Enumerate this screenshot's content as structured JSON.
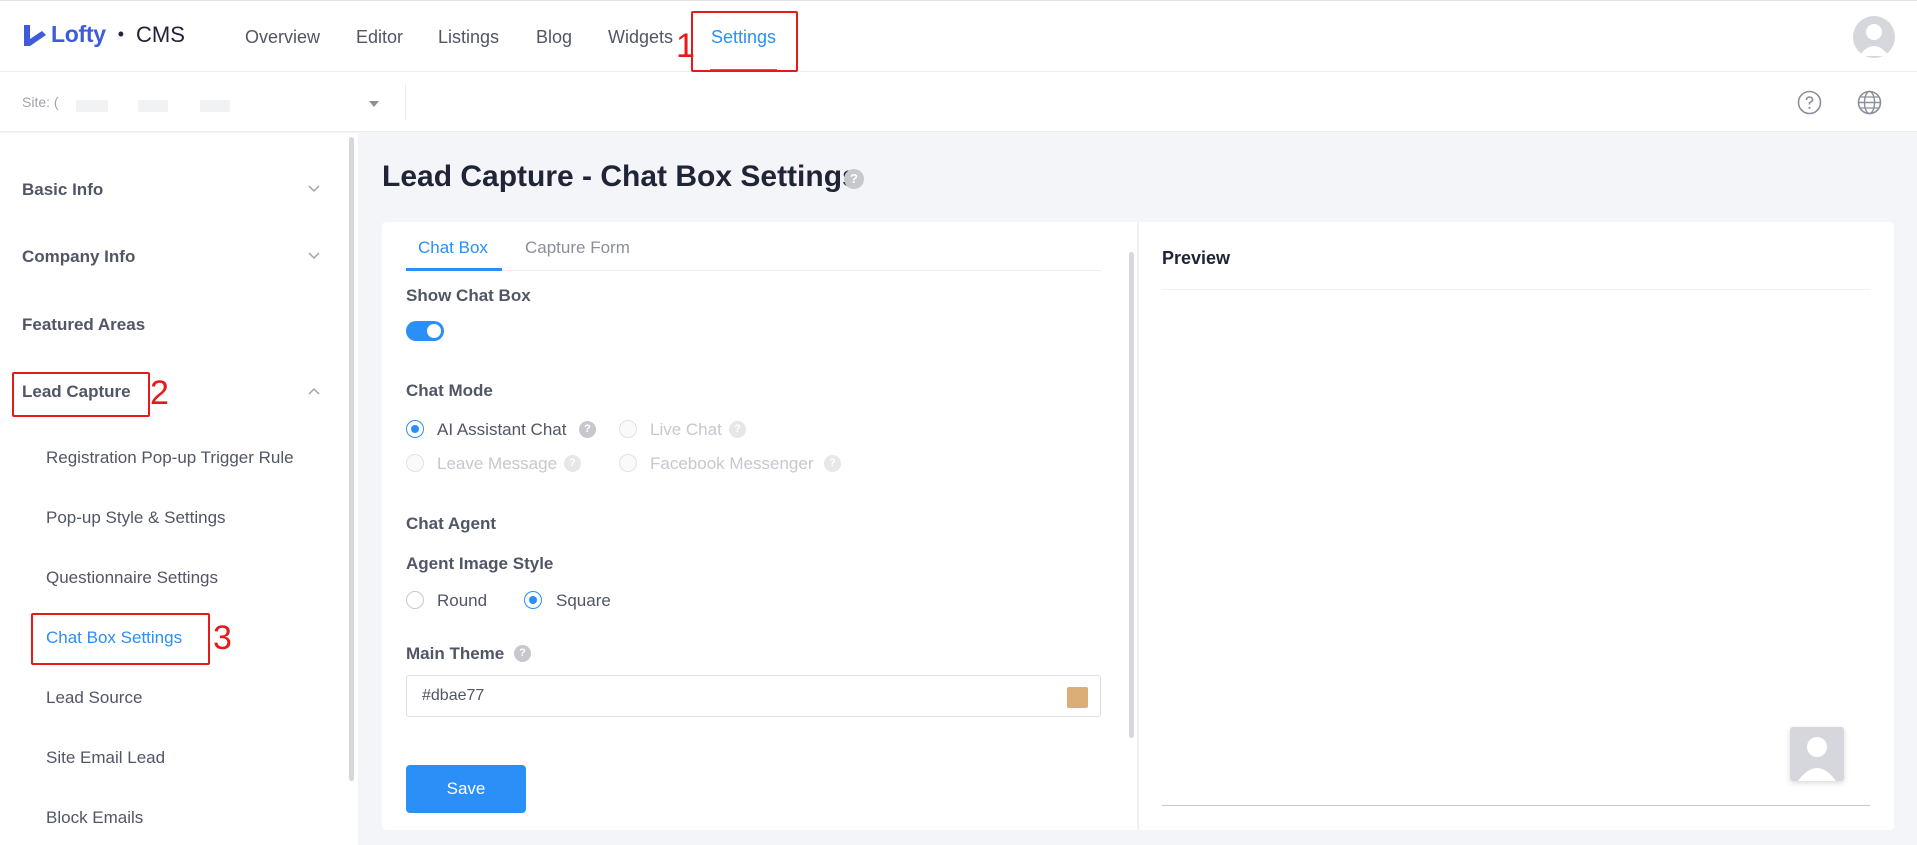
{
  "brand": {
    "logo": "Lofty",
    "separator": "•",
    "product": "CMS",
    "brand_color": "#3d5bdb"
  },
  "nav": {
    "items": [
      "Overview",
      "Editor",
      "Listings",
      "Blog",
      "Widgets",
      "Settings"
    ],
    "active": "Settings"
  },
  "subbar": {
    "site_label": "Site: ("
  },
  "sidebar": {
    "groups": [
      {
        "label": "Basic Info",
        "expanded": false
      },
      {
        "label": "Company Info",
        "expanded": false
      },
      {
        "label": "Featured Areas"
      },
      {
        "label": "Lead Capture",
        "expanded": true
      }
    ],
    "sub_items": [
      "Registration Pop-up Trigger Rule",
      "Pop-up Style & Settings",
      "Questionnaire Settings",
      "Chat Box Settings",
      "Lead Source",
      "Site Email Lead",
      "Block Emails"
    ],
    "active_sub": "Chat Box Settings"
  },
  "page": {
    "title": "Lead Capture - Chat Box Settings",
    "help": "?"
  },
  "tabs": {
    "items": [
      "Chat Box",
      "Capture Form"
    ],
    "active": "Chat Box"
  },
  "form": {
    "show_chat_box": {
      "label": "Show Chat Box",
      "on": true
    },
    "chat_mode": {
      "label": "Chat Mode",
      "options": [
        {
          "label": "AI Assistant Chat",
          "selected": true,
          "disabled": false
        },
        {
          "label": "Live Chat",
          "selected": false,
          "disabled": true
        },
        {
          "label": "Leave Message",
          "selected": false,
          "disabled": true
        },
        {
          "label": "Facebook Messenger",
          "selected": false,
          "disabled": true
        }
      ]
    },
    "chat_agent": {
      "label": "Chat Agent"
    },
    "agent_image_style": {
      "label": "Agent Image Style",
      "options": [
        {
          "label": "Round",
          "selected": false
        },
        {
          "label": "Square",
          "selected": true
        }
      ]
    },
    "main_theme": {
      "label": "Main Theme",
      "value": "#dbae77",
      "swatch_color": "#dbae77"
    },
    "save_label": "Save"
  },
  "preview": {
    "title": "Preview"
  },
  "annotations": [
    "1",
    "2",
    "3"
  ],
  "colors": {
    "accent": "#2a8ff7",
    "annotation": "#e81919"
  }
}
